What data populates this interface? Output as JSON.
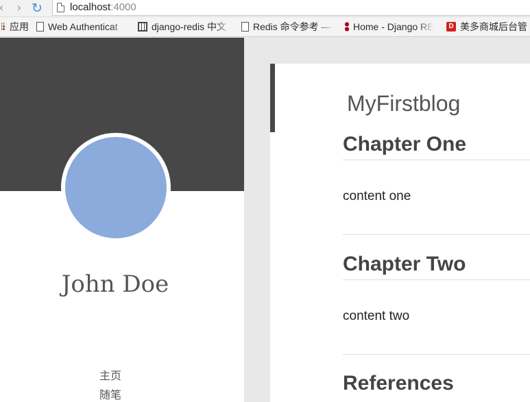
{
  "browser": {
    "url_host": "localhost",
    "url_port": ":4000",
    "bookmarks": [
      {
        "label": "应用",
        "icon": "apps-grid-icon"
      },
      {
        "label": "Web Authenticat",
        "icon": "document-icon"
      },
      {
        "label": "django-redis 中文",
        "icon": "book-icon"
      },
      {
        "label": "Redis 命令参考 —",
        "icon": "document-icon"
      },
      {
        "label": "Home - Django RE",
        "icon": "django-icon"
      },
      {
        "label": "美多商城后台管",
        "icon": "store-icon"
      }
    ]
  },
  "sidebar": {
    "author_name": "John Doe",
    "nav": [
      "主页",
      "随笔"
    ]
  },
  "main": {
    "blog_title": "MyFirstblog",
    "posts": [
      {
        "title": "Chapter One",
        "body": "content one"
      },
      {
        "title": "Chapter Two",
        "body": "content two"
      },
      {
        "title": "References",
        "body": ""
      }
    ]
  },
  "colors": {
    "banner": "#474747",
    "avatar": "#8aabdc",
    "page_background": "#e8e8e8"
  }
}
